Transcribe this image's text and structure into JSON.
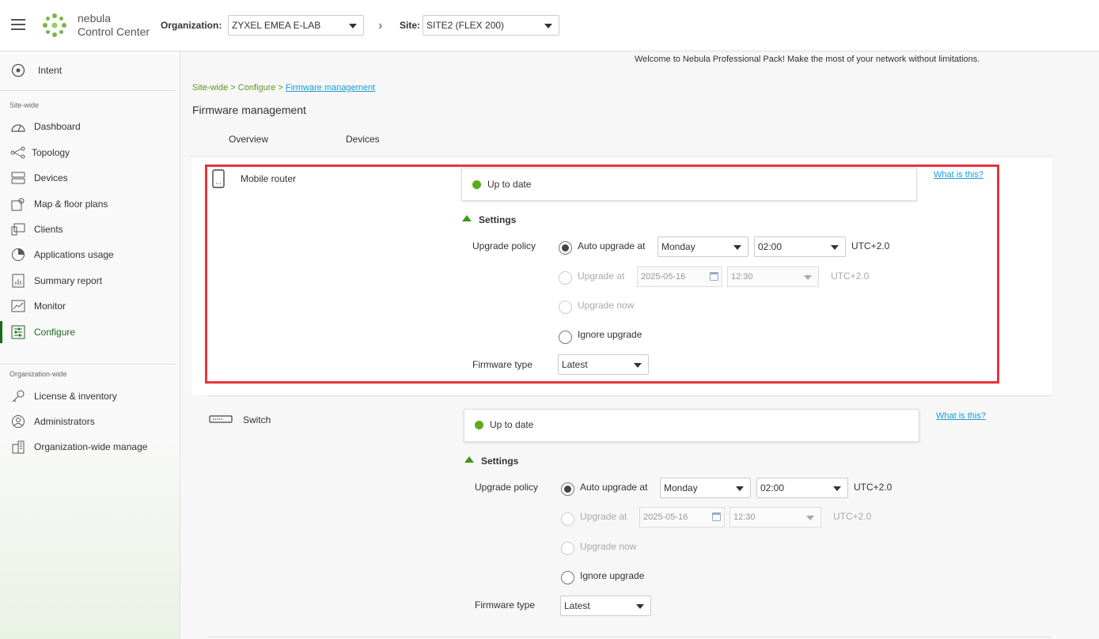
{
  "header": {
    "logo_line1": "nebula",
    "logo_line2": "Control Center",
    "org_label": "Organization:",
    "org_value": "ZYXEL EMEA E-LAB",
    "site_label": "Site:",
    "site_value": "SITE2 (FLEX 200)"
  },
  "sidebar": {
    "intent": "Intent",
    "section_site": "Site-wide",
    "items": [
      {
        "label": "Dashboard",
        "icon": "dashboard-icon"
      },
      {
        "label": "Topology",
        "icon": "topology-icon"
      },
      {
        "label": "Devices",
        "icon": "devices-icon"
      },
      {
        "label": "Map & floor plans",
        "icon": "map-icon"
      },
      {
        "label": "Clients",
        "icon": "clients-icon"
      },
      {
        "label": "Applications usage",
        "icon": "pie-chart-icon"
      },
      {
        "label": "Summary report",
        "icon": "report-icon"
      },
      {
        "label": "Monitor",
        "icon": "monitor-icon"
      },
      {
        "label": "Configure",
        "icon": "configure-icon"
      }
    ],
    "section_org": "Organization-wide",
    "org_items": [
      {
        "label": "License & inventory",
        "icon": "key-icon"
      },
      {
        "label": "Administrators",
        "icon": "admin-icon"
      },
      {
        "label": "Organization-wide manage",
        "icon": "building-icon"
      }
    ]
  },
  "main": {
    "welcome": "Welcome to Nebula Professional Pack! Make the most of your network without limitations.",
    "breadcrumb": {
      "part1": "Site-wide",
      "sep1": " > ",
      "part2": "Configure",
      "sep2": " > ",
      "current": "Firmware management"
    },
    "title": "Firmware management",
    "tabs": [
      "Overview",
      "Devices"
    ]
  },
  "devices": [
    {
      "name": "Mobile router",
      "status": "Up to date",
      "what_is_this": "What is this?",
      "settings": "Settings",
      "upgrade_policy_label": "Upgrade policy",
      "auto_upgrade_label": "Auto upgrade at",
      "auto_day": "Monday",
      "auto_time": "02:00",
      "tz1": "UTC+2.0",
      "upgrade_at_label": "Upgrade at",
      "upgrade_date": "2025-05-16",
      "upgrade_time": "12:30",
      "tz2": "UTC+2.0",
      "upgrade_now_label": "Upgrade now",
      "ignore_label": "Ignore upgrade",
      "fw_type_label": "Firmware type",
      "fw_type": "Latest"
    },
    {
      "name": "Switch",
      "status": "Up to date",
      "what_is_this": "What is this?",
      "settings": "Settings",
      "upgrade_policy_label": "Upgrade policy",
      "auto_upgrade_label": "Auto upgrade at",
      "auto_day": "Monday",
      "auto_time": "02:00",
      "tz1": "UTC+2.0",
      "upgrade_at_label": "Upgrade at",
      "upgrade_date": "2025-05-16",
      "upgrade_time": "12:30",
      "tz2": "UTC+2.0",
      "upgrade_now_label": "Upgrade now",
      "ignore_label": "Ignore upgrade",
      "fw_type_label": "Firmware type",
      "fw_type": "Latest"
    }
  ],
  "colors": {
    "accent_green": "#5aad1a",
    "link_blue": "#1a9bd7",
    "highlight_red": "#e8343c",
    "active_nav": "#1b6a1b"
  }
}
